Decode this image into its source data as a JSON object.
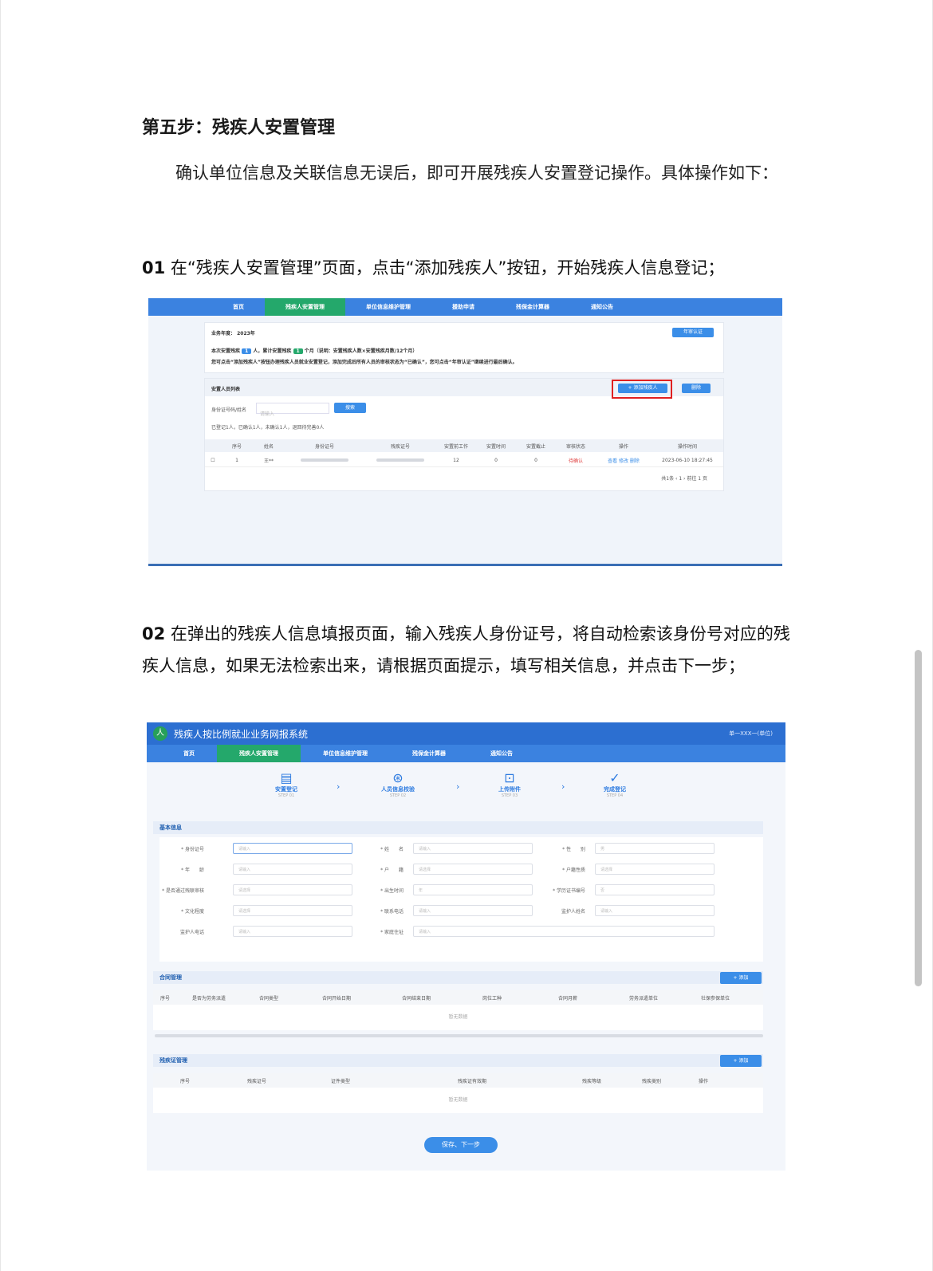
{
  "heading": "第五步：残疾人安置管理",
  "intro": "确认单位信息及关联信息无误后，即可开展残疾人安置登记操作。具体操作如下：",
  "step01": {
    "num": "01",
    "text": " 在“残疾人安置管理”页面，点击“添加残疾人”按钮，开始残疾人信息登记；"
  },
  "step02": {
    "num": "02",
    "text": " 在弹出的残疾人信息填报页面，输入残疾人身份证号，将自动检索该身份号对应的残疾人信息，如果无法检索出来，请根据页面提示，填写相关信息，并点击下一步；"
  },
  "shot1": {
    "nav": [
      "首页",
      "残疾人安置管理",
      "单位信息维护管理",
      "援助申请",
      "残保金计算器",
      "通知公告"
    ],
    "year_label": "业务年度：",
    "year_value": "2023年",
    "btn_top": "年审认证",
    "count_line_1": "本次安置残疾",
    "count_badge_1": "1",
    "count_line_2": "人，累计安置残疾",
    "count_badge_2": "1",
    "count_line_3": "个月（说明：安置残疾人数×安置残疾月数/12个月）",
    "notice": "您可点击“添加残疾人”按钮办理残疾人员就业安置登记，添加完成后所有人员的审核状态为“已确认”，您可点击“年审认证”继续进行最后确认。",
    "list_title": "安置人员列表",
    "add_btn": "+ 添加残疾人",
    "del_btn": "删除",
    "search_label": "身份证号码/姓名",
    "search_placeholder": "请输入",
    "search_btn": "搜索",
    "stats": "已登记1人，已确认1人，未确认1人，退回待完善0人",
    "columns": [
      "",
      "序号",
      "姓名",
      "身份证号",
      "残疾证号",
      "安置前工作",
      "安置时间",
      "安置截止",
      "审核状态",
      "操作",
      "操作时间"
    ],
    "row": [
      "",
      "1",
      "王**",
      "",
      "",
      "12",
      "0",
      "0",
      "待确认",
      "查看 修改 删除",
      "2023-06-10 18:27:45"
    ],
    "pager": "共1条  ‹ 1 ›  前往 1 页"
  },
  "shot2": {
    "sys_title": "残疾人按比例就业业务网报系统",
    "user": "单一XXX一(单位)",
    "nav": [
      "首页",
      "残疾人安置管理",
      "单位信息维护管理",
      "残保金计算器",
      "通知公告"
    ],
    "steps": [
      {
        "icon": "▤",
        "label": "安置登记",
        "sub": "STEP 01"
      },
      {
        "icon": "⊛",
        "label": "人员信息校验",
        "sub": "STEP 02"
      },
      {
        "icon": "⊡",
        "label": "上传附件",
        "sub": "STEP 03"
      },
      {
        "icon": "✓",
        "label": "完成登记",
        "sub": "STEP 04"
      }
    ],
    "section_basic": "基本信息",
    "fields": [
      {
        "label": "* 身份证号",
        "ph": "请输入"
      },
      {
        "label": "* 姓　　名",
        "ph": "请输入"
      },
      {
        "label": "* 性　　别",
        "ph": "男"
      },
      {
        "label": "* 年　　龄",
        "ph": "请输入"
      },
      {
        "label": "* 户　　籍",
        "ph": "请选择"
      },
      {
        "label": "* 户籍性质",
        "ph": "请选择"
      },
      {
        "label": "* 是否通过残联审核",
        "ph": "请选择"
      },
      {
        "label": "* 出生时间",
        "ph": "年"
      },
      {
        "label": "* 学历证书编号",
        "ph": "否"
      },
      {
        "label": "* 文化程度",
        "ph": "请选择"
      },
      {
        "label": "* 联系电话",
        "ph": "请输入"
      },
      {
        "label": "监护人姓名",
        "ph": "请输入"
      },
      {
        "label": "监护人电话",
        "ph": "请输入"
      },
      {
        "label": "* 家庭住址",
        "ph": "请输入"
      }
    ],
    "section_contract": "合同管理",
    "add_contract": "+ 添加",
    "contract_cols": [
      "序号",
      "是否为劳务派遣",
      "合同类型",
      "合同开始日期",
      "合同结束日期",
      "岗位工种",
      "合同月薪",
      "劳务派遣单位",
      "社保参保单位"
    ],
    "empty1": "暂无数据",
    "section_cert": "残疾证管理",
    "add_cert": "+ 添加",
    "cert_cols": [
      "序号",
      "残疾证号",
      "证件类型",
      "残疾证有效期",
      "残疾等级",
      "残疾类别",
      "操作"
    ],
    "empty2": "暂无数据",
    "save_btn": "保存、下一步"
  }
}
